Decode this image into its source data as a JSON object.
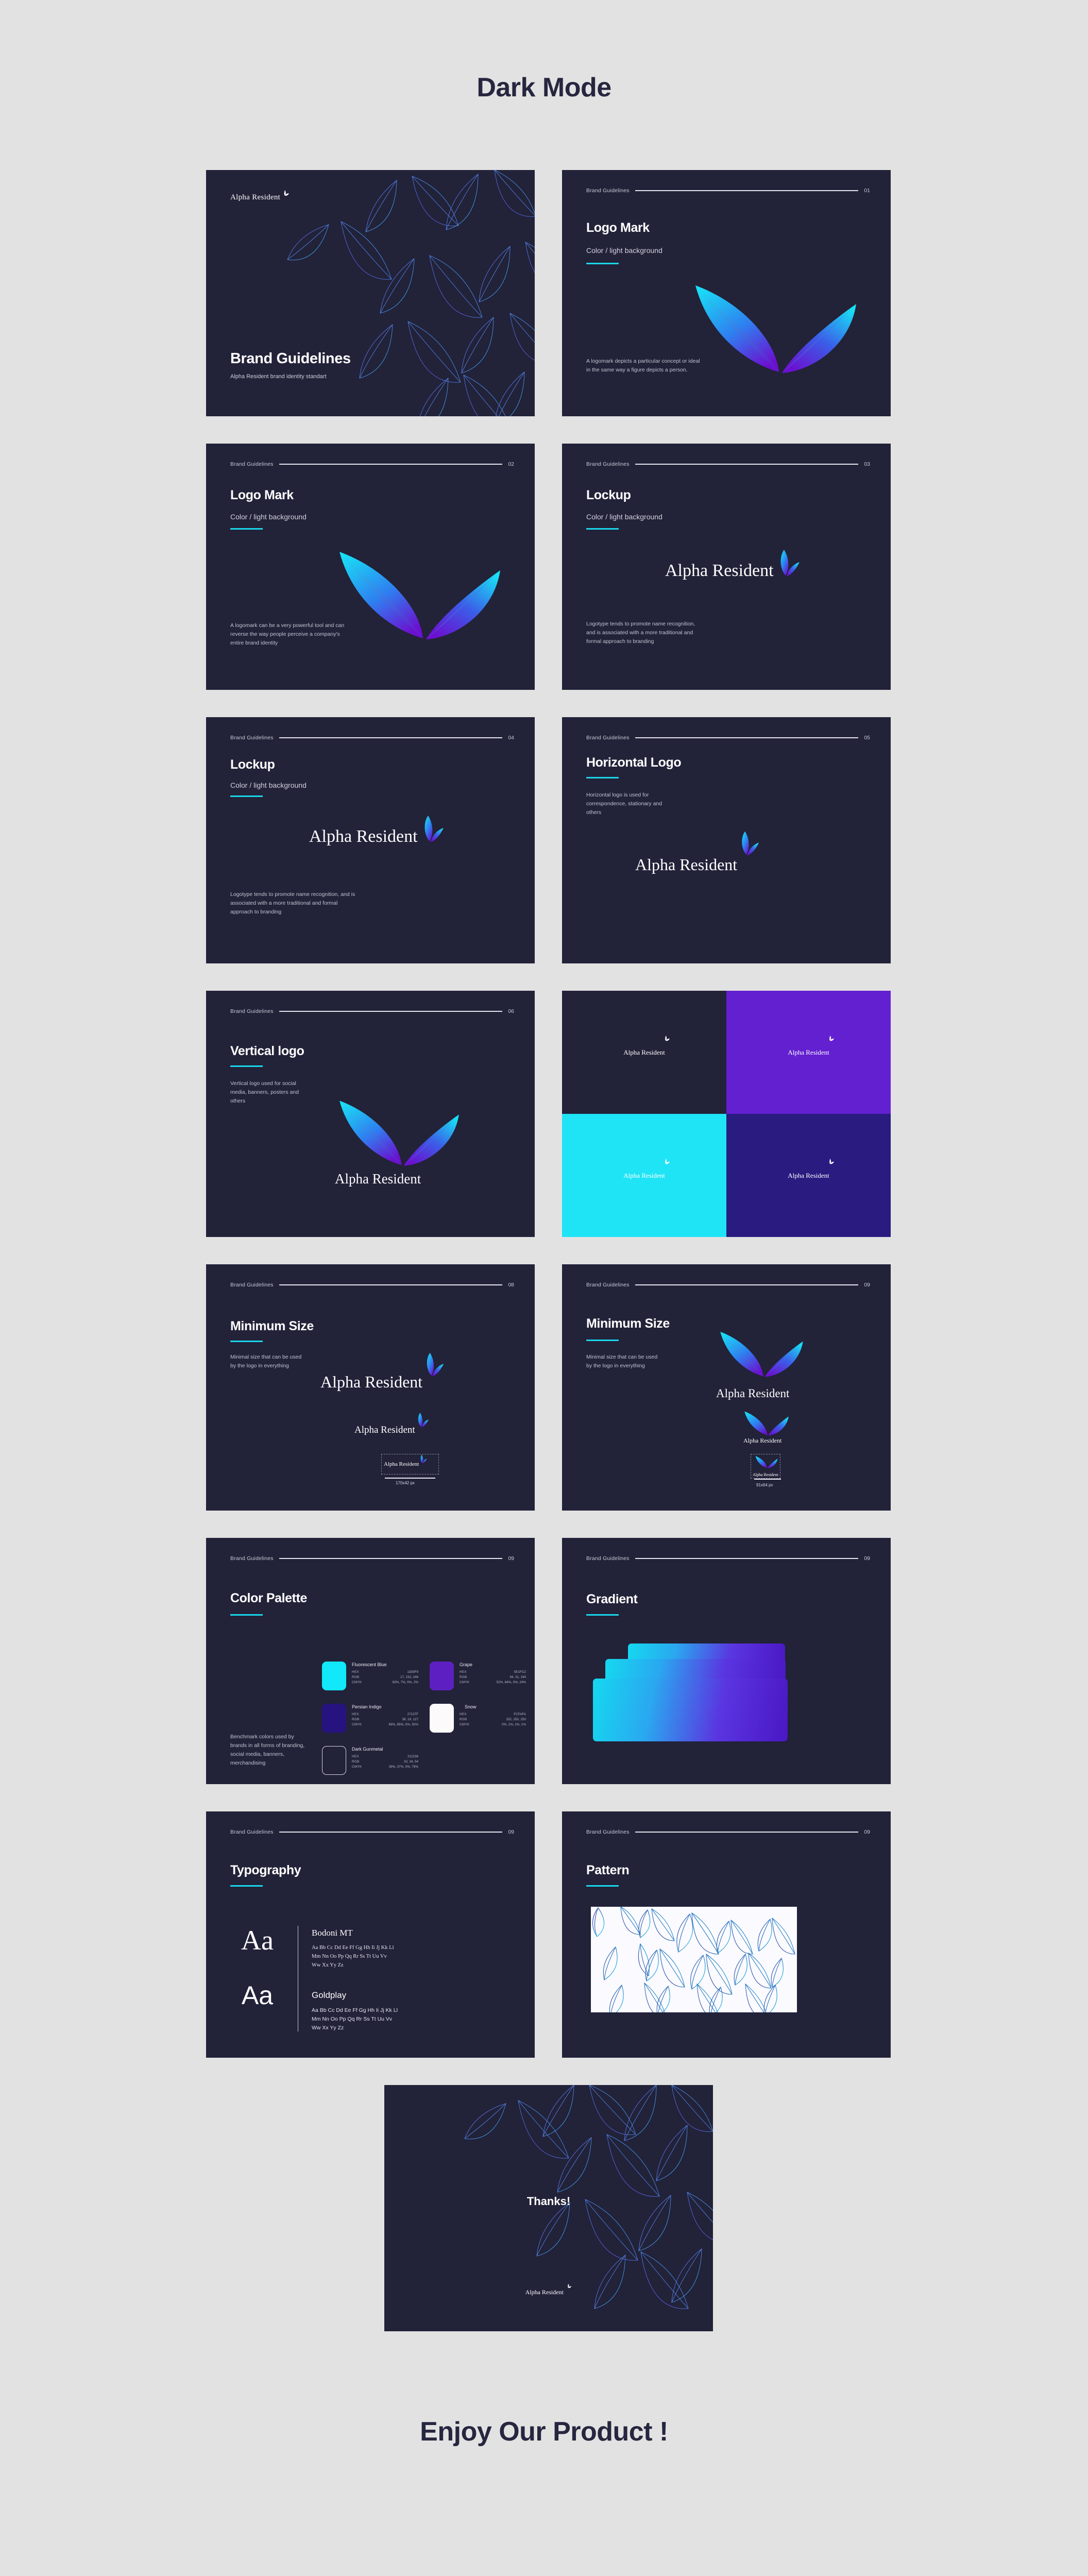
{
  "page": {
    "title": "Dark Mode",
    "footer": "Enjoy Our Product !"
  },
  "brand": {
    "name": "Alpha Resident",
    "header_label": "Brand Guidelines"
  },
  "colors": {
    "slide_bg": "#222239",
    "page_bg": "#e2e2e2",
    "accent": "#1ad6e8",
    "fluorescent_blue": "#11E8F9",
    "grape": "#5E1FC2",
    "persian_indigo": "#27137F",
    "snow": "#FCFAFA",
    "dark_gunmetal": "#212236"
  },
  "slides": {
    "cover": {
      "logo": "Alpha Resident",
      "title": "Brand Guidelines",
      "subtitle": "Alpha Resident brand identity standart"
    },
    "logo_mark_01": {
      "number": "01",
      "title": "Logo Mark",
      "subtitle": "Color / light background",
      "body": "A logomark depicts a particular concept or ideal in the same way a figure depicts a person."
    },
    "logo_mark_02": {
      "number": "02",
      "title": "Logo Mark",
      "subtitle": "Color / light background",
      "body": "A logomark can be a very powerful tool and can reverse the way people perceive a company's entire brand identity"
    },
    "lockup_03": {
      "number": "03",
      "title": "Lockup",
      "subtitle": "Color / light background",
      "body": "Logotype tends to promote name recognition, and is associated with a more traditional and formal approach to branding",
      "wordmark": "Alpha Resident"
    },
    "lockup_04": {
      "number": "04",
      "title": "Lockup",
      "subtitle": "Color / light background",
      "body": "Logotype tends to promote name recognition, and is associated with a more traditional and formal approach to branding",
      "wordmark": "Alpha Resident"
    },
    "horizontal_05": {
      "number": "05",
      "title": "Horizontal Logo",
      "body": "Horizontal logo is used for correspondence, stationary and others",
      "wordmark": "Alpha Resident"
    },
    "vertical_06": {
      "number": "06",
      "title": "Vertical logo",
      "body": "Vertical  logo used for social media, banners, posters and others",
      "wordmark": "Alpha Resident"
    },
    "variants_07": {
      "quadrants": [
        {
          "bg": "#222239",
          "label": "Alpha Resident"
        },
        {
          "bg": "#6320D0",
          "label": "Alpha Resident"
        },
        {
          "bg": "#1FE4F5",
          "label": "Alpha Resident"
        },
        {
          "bg": "#2A1B80",
          "label": "Alpha Resident"
        }
      ]
    },
    "min_size_08": {
      "number": "08",
      "title": "Minimum Size",
      "body": "Minimal size that can be used by the logo in everything",
      "wordmark": "Alpha Resident",
      "caption": "170x42 px"
    },
    "min_size_09": {
      "number": "09",
      "title": "Minimum Size",
      "body": "Minimal size that can be used by the logo in everything",
      "wordmark": "Alpha Resident",
      "caption": "91x64 px"
    },
    "palette_09": {
      "number": "09",
      "title": "Color Palette",
      "body": "Benchmark colors used by brands in all forms of branding, social media, banners, merchandising",
      "labels": {
        "hex": "HEX",
        "rgb": "RGB",
        "cmyk": "CMYK"
      },
      "swatches": [
        {
          "name": "Fluorescent Blue",
          "hex": "11E8F9",
          "rgb": "17, 232, 249",
          "cmyk": "93%, 7%, 0%, 2%",
          "color": "#11E8F9",
          "outline": false
        },
        {
          "name": "Grape",
          "hex": "5E1FC2",
          "rgb": "94, 31, 194",
          "cmyk": "52%, 84%, 0%, 24%",
          "color": "#5E1FC2",
          "outline": false
        },
        {
          "name": "Persian Indigo",
          "hex": "27137F",
          "rgb": "39, 19, 127",
          "cmyk": "69%, 85%, 0%, 50%",
          "color": "#27137F",
          "outline": false
        },
        {
          "name": "Snow",
          "hex": "FCFAFA",
          "rgb": "252, 250, 250",
          "cmyk": "0%, 1%, 1%, 1%",
          "color": "#FCFAFA",
          "outline": false
        },
        {
          "name": "Dark Gunmetal",
          "hex": "212236",
          "rgb": "33, 34, 54",
          "cmyk": "39%, 37%, 0%, 79%",
          "color": "#212236",
          "outline": true
        }
      ]
    },
    "gradient_09": {
      "number": "09",
      "title": "Gradient"
    },
    "typography_09": {
      "number": "09",
      "title": "Typography",
      "sample_char": "Aa",
      "fonts": [
        {
          "name": "Bodoni MT",
          "lines": [
            "Aa Bb Cc Dd Ee Ff Gg Hh Ii Jj Kk Ll",
            "Mm Nn Oo Pp Qq Rr Ss Tt Uu Vv",
            "Ww Xx Yy Zz"
          ]
        },
        {
          "name": "Goldplay",
          "lines": [
            "Aa Bb Cc Dd Ee Ff Gg Hh Ii Jj Kk Ll",
            "Mm Nn Oo Pp Qq Rr Ss Tt Uu Vv",
            "Ww Xx Yy Zz"
          ]
        }
      ]
    },
    "pattern_09": {
      "number": "09",
      "title": "Pattern"
    },
    "thanks": {
      "title": "Thanks!",
      "logo": "Alpha Resident"
    }
  }
}
